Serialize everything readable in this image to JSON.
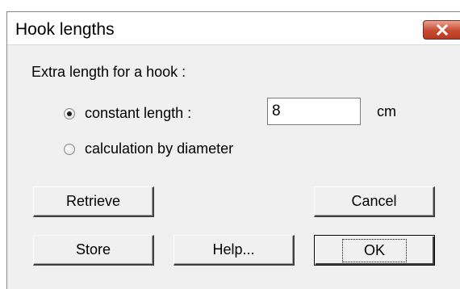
{
  "dialog": {
    "title": "Hook lengths",
    "close_icon": "close-x-icon"
  },
  "form": {
    "prompt": "Extra length for a hook :",
    "option_constant": "constant length :",
    "option_diameter": "calculation by diameter",
    "selected_option": "constant length :",
    "constant_value": "8",
    "unit": "cm"
  },
  "buttons": {
    "retrieve": "Retrieve",
    "cancel": "Cancel",
    "store": "Store",
    "help": "Help...",
    "ok": "OK"
  },
  "colors": {
    "window_bg": "#f0f0f0",
    "close_button": "#c74a31"
  }
}
